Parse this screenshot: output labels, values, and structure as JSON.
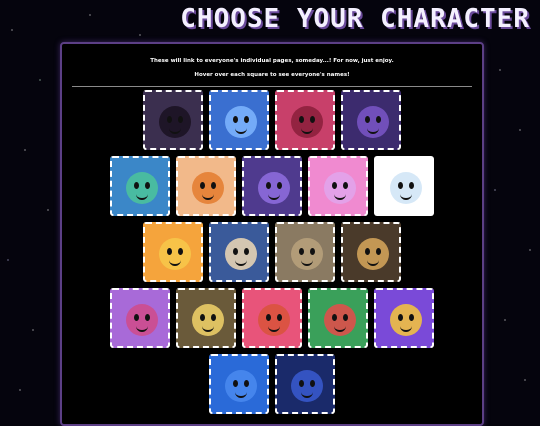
{
  "page": {
    "title": "CHOOSE YOUR CHARACTER",
    "intro_line1": "These will link to everyone's individual pages, someday...! For now, just enjoy.",
    "intro_line2": "Hover over each square to see everyone's names!"
  },
  "rows": [
    [
      {
        "bg": "#3b2f4f",
        "face": "#1a1020"
      },
      {
        "bg": "#3a6fd0",
        "face": "#7fb6ff"
      },
      {
        "bg": "#c8406a",
        "face": "#8a1f3a"
      },
      {
        "bg": "#3c2b6e",
        "face": "#7a56c8"
      }
    ],
    [
      {
        "bg": "#3b87c8",
        "face": "#4cc49a"
      },
      {
        "bg": "#f2b98a",
        "face": "#e47b2e"
      },
      {
        "bg": "#4f3a8e",
        "face": "#8f6ee0"
      },
      {
        "bg": "#f08ad0",
        "face": "#e0a4ec"
      },
      {
        "bg": "#ffffff",
        "face": "#cfe4f6"
      }
    ],
    [
      {
        "bg": "#f5a43c",
        "face": "#f7c94a"
      },
      {
        "bg": "#3a5a9a",
        "face": "#f0d9b5"
      },
      {
        "bg": "#8a7a62",
        "face": "#b9a27c"
      },
      {
        "bg": "#4a3a2a",
        "face": "#d8a85c"
      }
    ],
    [
      {
        "bg": "#a86ad8",
        "face": "#d04a8a"
      },
      {
        "bg": "#6a5a3a",
        "face": "#f2d46a"
      },
      {
        "bg": "#e8547a",
        "face": "#d8543a"
      },
      {
        "bg": "#3aa05a",
        "face": "#e84a4a"
      },
      {
        "bg": "#7a4ad8",
        "face": "#f7c73a"
      }
    ],
    [
      {
        "bg": "#2a6ad8",
        "face": "#4a8af0"
      },
      {
        "bg": "#1a2a6a",
        "face": "#3a5ad0"
      }
    ]
  ]
}
